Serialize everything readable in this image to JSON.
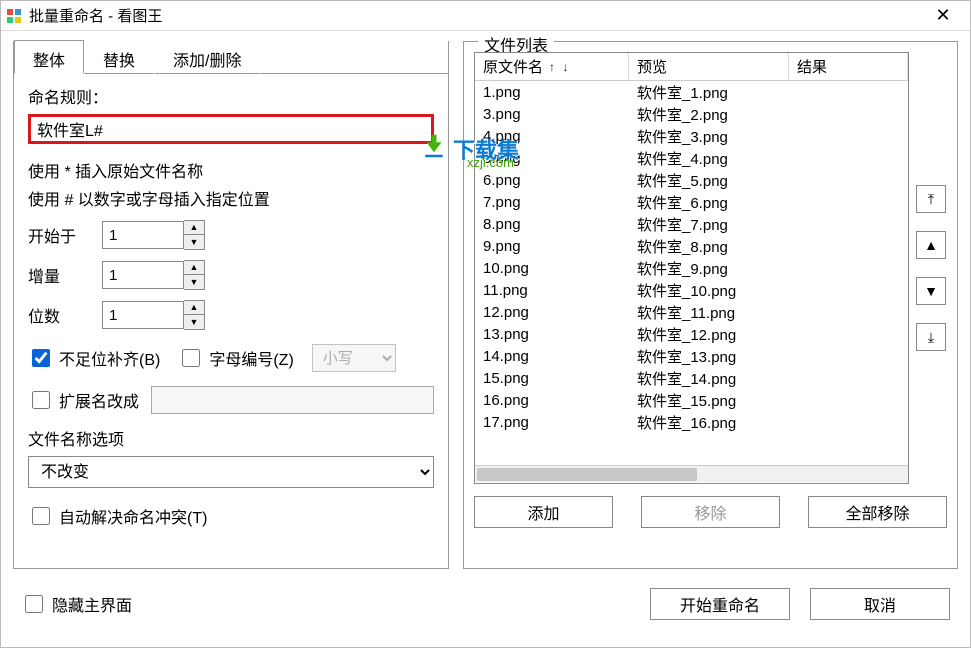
{
  "window": {
    "title": "批量重命名 - 看图王"
  },
  "tabs": {
    "t1": "整体",
    "t2": "替换",
    "t3": "添加/删除"
  },
  "left": {
    "naming_rule_label": "命名规则：",
    "naming_rule_value": "软件室L#",
    "hint1": "使用 * 插入原始文件名称",
    "hint2": "使用 # 以数字或字母插入指定位置",
    "start_label": "开始于",
    "start_value": "1",
    "step_label": "增量",
    "step_value": "1",
    "digits_label": "位数",
    "digits_value": "1",
    "pad_label": "不足位补齐(B)",
    "pad_checked": true,
    "alpha_label": "字母编号(Z)",
    "alpha_checked": false,
    "case_value": "小写",
    "ext_label": "扩展名改成",
    "ext_checked": false,
    "ext_value": "",
    "nameopt_label": "文件名称选项",
    "nameopt_value": "不改变",
    "autoresolve_label": "自动解决命名冲突(T)",
    "autoresolve_checked": false
  },
  "right": {
    "legend": "文件列表",
    "col1": "原文件名",
    "col2": "预览",
    "col3": "结果",
    "rows": [
      {
        "name": "1.png",
        "preview": "软件室_1.png"
      },
      {
        "name": "3.png",
        "preview": "软件室_2.png"
      },
      {
        "name": "4.png",
        "preview": "软件室_3.png"
      },
      {
        "name": "5.png",
        "preview": "软件室_4.png"
      },
      {
        "name": "6.png",
        "preview": "软件室_5.png"
      },
      {
        "name": "7.png",
        "preview": "软件室_6.png"
      },
      {
        "name": "8.png",
        "preview": "软件室_7.png"
      },
      {
        "name": "9.png",
        "preview": "软件室_8.png"
      },
      {
        "name": "10.png",
        "preview": "软件室_9.png"
      },
      {
        "name": "11.png",
        "preview": "软件室_10.png"
      },
      {
        "name": "12.png",
        "preview": "软件室_11.png"
      },
      {
        "name": "13.png",
        "preview": "软件室_12.png"
      },
      {
        "name": "14.png",
        "preview": "软件室_13.png"
      },
      {
        "name": "15.png",
        "preview": "软件室_14.png"
      },
      {
        "name": "16.png",
        "preview": "软件室_15.png"
      },
      {
        "name": "17.png",
        "preview": "软件室_16.png"
      }
    ],
    "btn_add": "添加",
    "btn_remove": "移除",
    "btn_remove_all": "全部移除"
  },
  "bottom": {
    "hide_label": "隐藏主界面",
    "hide_checked": false,
    "btn_start": "开始重命名",
    "btn_cancel": "取消"
  },
  "watermark": {
    "text": "下载集",
    "sub": "xzji.com"
  }
}
